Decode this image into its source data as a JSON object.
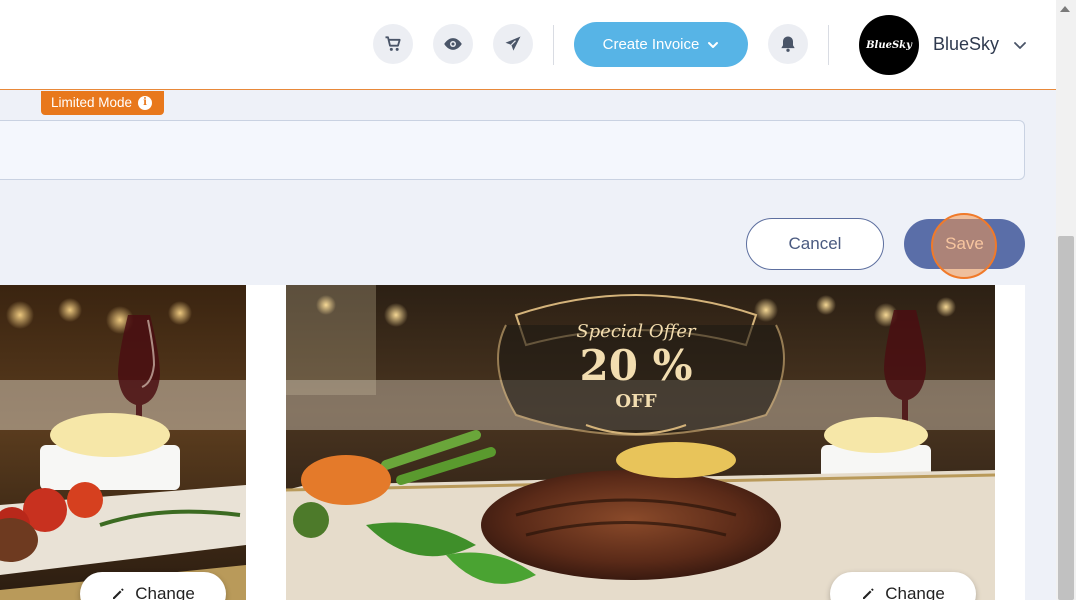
{
  "header": {
    "icons": [
      "cart-icon",
      "eye-icon",
      "send-icon",
      "bell-icon"
    ],
    "create_invoice_label": "Create Invoice",
    "avatar_text": "BlueSky",
    "username": "BlueSky"
  },
  "limited_mode": {
    "label": "Limited Mode",
    "icon_glyph": "i"
  },
  "form": {
    "field_value": ""
  },
  "actions": {
    "cancel_label": "Cancel",
    "save_label": "Save"
  },
  "images": [
    {
      "name": "steak-dinner-image",
      "change_label": "Change"
    },
    {
      "name": "special-offer-image",
      "offer_title": "Special Offer",
      "offer_percent": "20 %",
      "offer_off": "OFF",
      "change_label": "Change"
    }
  ],
  "colors": {
    "accent_orange": "#e8781c",
    "primary_blue": "#5a6ea8",
    "create_blue": "#57b4e6"
  }
}
